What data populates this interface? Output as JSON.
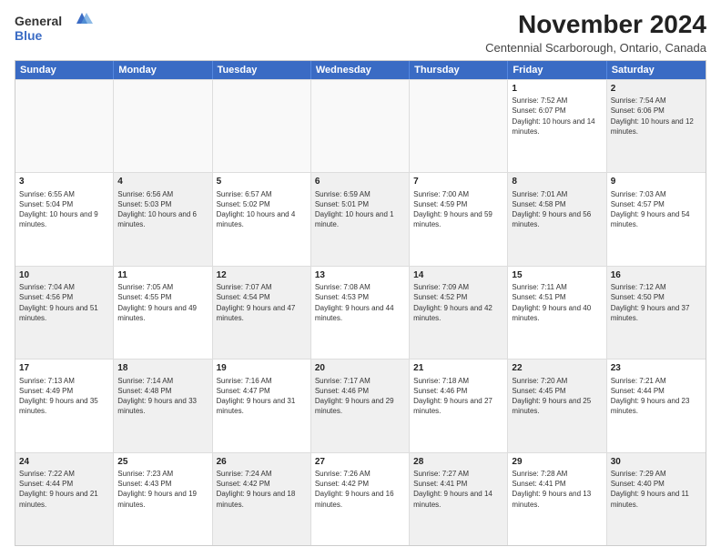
{
  "logo": {
    "line1": "General",
    "line2": "Blue"
  },
  "title": "November 2024",
  "subtitle": "Centennial Scarborough, Ontario, Canada",
  "days": [
    "Sunday",
    "Monday",
    "Tuesday",
    "Wednesday",
    "Thursday",
    "Friday",
    "Saturday"
  ],
  "weeks": [
    [
      {
        "day": "",
        "info": "",
        "empty": true
      },
      {
        "day": "",
        "info": "",
        "empty": true
      },
      {
        "day": "",
        "info": "",
        "empty": true
      },
      {
        "day": "",
        "info": "",
        "empty": true
      },
      {
        "day": "",
        "info": "",
        "empty": true
      },
      {
        "day": "1",
        "info": "Sunrise: 7:52 AM\nSunset: 6:07 PM\nDaylight: 10 hours and 14 minutes."
      },
      {
        "day": "2",
        "info": "Sunrise: 7:54 AM\nSunset: 6:06 PM\nDaylight: 10 hours and 12 minutes.",
        "shaded": true
      }
    ],
    [
      {
        "day": "3",
        "info": "Sunrise: 6:55 AM\nSunset: 5:04 PM\nDaylight: 10 hours and 9 minutes."
      },
      {
        "day": "4",
        "info": "Sunrise: 6:56 AM\nSunset: 5:03 PM\nDaylight: 10 hours and 6 minutes.",
        "shaded": true
      },
      {
        "day": "5",
        "info": "Sunrise: 6:57 AM\nSunset: 5:02 PM\nDaylight: 10 hours and 4 minutes."
      },
      {
        "day": "6",
        "info": "Sunrise: 6:59 AM\nSunset: 5:01 PM\nDaylight: 10 hours and 1 minute.",
        "shaded": true
      },
      {
        "day": "7",
        "info": "Sunrise: 7:00 AM\nSunset: 4:59 PM\nDaylight: 9 hours and 59 minutes."
      },
      {
        "day": "8",
        "info": "Sunrise: 7:01 AM\nSunset: 4:58 PM\nDaylight: 9 hours and 56 minutes.",
        "shaded": true
      },
      {
        "day": "9",
        "info": "Sunrise: 7:03 AM\nSunset: 4:57 PM\nDaylight: 9 hours and 54 minutes."
      }
    ],
    [
      {
        "day": "10",
        "info": "Sunrise: 7:04 AM\nSunset: 4:56 PM\nDaylight: 9 hours and 51 minutes.",
        "shaded": true
      },
      {
        "day": "11",
        "info": "Sunrise: 7:05 AM\nSunset: 4:55 PM\nDaylight: 9 hours and 49 minutes."
      },
      {
        "day": "12",
        "info": "Sunrise: 7:07 AM\nSunset: 4:54 PM\nDaylight: 9 hours and 47 minutes.",
        "shaded": true
      },
      {
        "day": "13",
        "info": "Sunrise: 7:08 AM\nSunset: 4:53 PM\nDaylight: 9 hours and 44 minutes."
      },
      {
        "day": "14",
        "info": "Sunrise: 7:09 AM\nSunset: 4:52 PM\nDaylight: 9 hours and 42 minutes.",
        "shaded": true
      },
      {
        "day": "15",
        "info": "Sunrise: 7:11 AM\nSunset: 4:51 PM\nDaylight: 9 hours and 40 minutes."
      },
      {
        "day": "16",
        "info": "Sunrise: 7:12 AM\nSunset: 4:50 PM\nDaylight: 9 hours and 37 minutes.",
        "shaded": true
      }
    ],
    [
      {
        "day": "17",
        "info": "Sunrise: 7:13 AM\nSunset: 4:49 PM\nDaylight: 9 hours and 35 minutes."
      },
      {
        "day": "18",
        "info": "Sunrise: 7:14 AM\nSunset: 4:48 PM\nDaylight: 9 hours and 33 minutes.",
        "shaded": true
      },
      {
        "day": "19",
        "info": "Sunrise: 7:16 AM\nSunset: 4:47 PM\nDaylight: 9 hours and 31 minutes."
      },
      {
        "day": "20",
        "info": "Sunrise: 7:17 AM\nSunset: 4:46 PM\nDaylight: 9 hours and 29 minutes.",
        "shaded": true
      },
      {
        "day": "21",
        "info": "Sunrise: 7:18 AM\nSunset: 4:46 PM\nDaylight: 9 hours and 27 minutes."
      },
      {
        "day": "22",
        "info": "Sunrise: 7:20 AM\nSunset: 4:45 PM\nDaylight: 9 hours and 25 minutes.",
        "shaded": true
      },
      {
        "day": "23",
        "info": "Sunrise: 7:21 AM\nSunset: 4:44 PM\nDaylight: 9 hours and 23 minutes."
      }
    ],
    [
      {
        "day": "24",
        "info": "Sunrise: 7:22 AM\nSunset: 4:44 PM\nDaylight: 9 hours and 21 minutes.",
        "shaded": true
      },
      {
        "day": "25",
        "info": "Sunrise: 7:23 AM\nSunset: 4:43 PM\nDaylight: 9 hours and 19 minutes."
      },
      {
        "day": "26",
        "info": "Sunrise: 7:24 AM\nSunset: 4:42 PM\nDaylight: 9 hours and 18 minutes.",
        "shaded": true
      },
      {
        "day": "27",
        "info": "Sunrise: 7:26 AM\nSunset: 4:42 PM\nDaylight: 9 hours and 16 minutes."
      },
      {
        "day": "28",
        "info": "Sunrise: 7:27 AM\nSunset: 4:41 PM\nDaylight: 9 hours and 14 minutes.",
        "shaded": true
      },
      {
        "day": "29",
        "info": "Sunrise: 7:28 AM\nSunset: 4:41 PM\nDaylight: 9 hours and 13 minutes."
      },
      {
        "day": "30",
        "info": "Sunrise: 7:29 AM\nSunset: 4:40 PM\nDaylight: 9 hours and 11 minutes.",
        "shaded": true
      }
    ]
  ]
}
